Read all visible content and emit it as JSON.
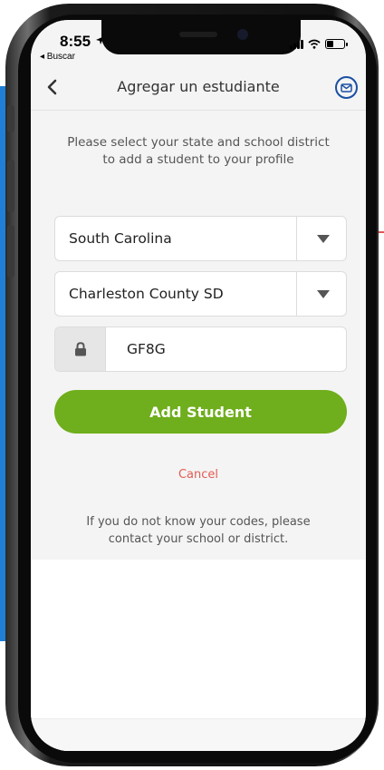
{
  "status_bar": {
    "time": "8:55",
    "back_app": "◂ Buscar"
  },
  "nav": {
    "title": "Agregar un estudiante",
    "back_icon": "chevron-left-icon",
    "mail_icon": "mail-icon"
  },
  "form": {
    "instructions": "Please select your state and school district to add a student to your profile",
    "state_value": "South Carolina",
    "district_value": "Charleston County SD",
    "code_value": "GF8G",
    "add_button_label": "Add Student",
    "cancel_label": "Cancel",
    "help_text": "If you do not know your codes, please contact your school or district."
  },
  "colors": {
    "accent_green": "#6fae1c",
    "cancel_red": "#e25c52",
    "mail_blue": "#1a4fa3",
    "backdrop_blue": "#1f7fd6"
  }
}
